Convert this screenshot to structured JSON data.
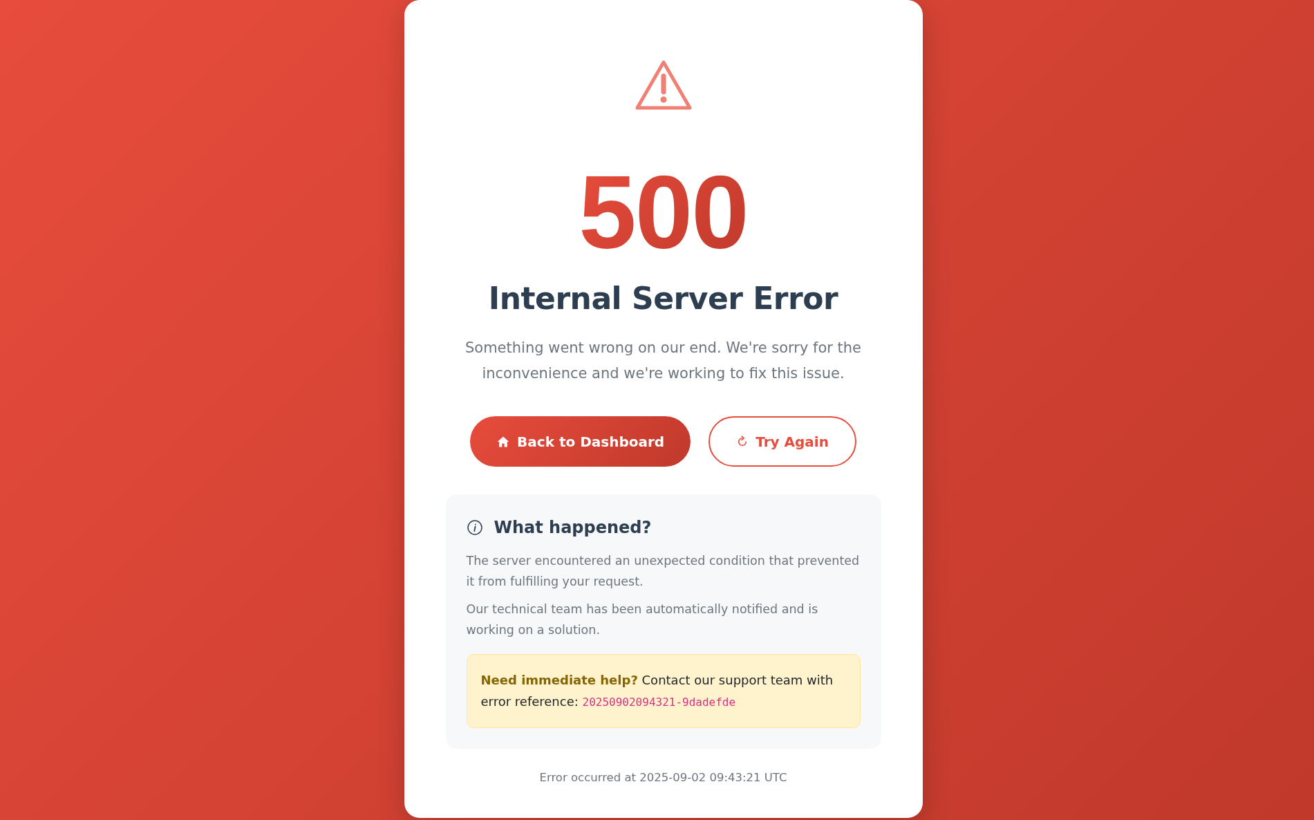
{
  "error": {
    "code": "500",
    "title": "Internal Server Error",
    "description": "Something went wrong on our end. We're sorry for the inconvenience and we're working to fix this issue."
  },
  "buttons": [
    {
      "kind": "primary",
      "label": "Back to Dashboard"
    },
    {
      "kind": "outline",
      "label": "Try Again"
    }
  ],
  "details": {
    "heading": "What happened?",
    "paragraphs": [
      "The server encountered an unexpected condition that prevented it from fulfilling your request.",
      "Our technical team has been automatically notified and is working on a solution."
    ],
    "help": {
      "text": "**Need immediate help?** Contact our support team with error reference:",
      "reference": "20250902094321-9dadefde"
    }
  },
  "footer": "Error occurred at 2025-09-02 09:43:21 UTC"
}
